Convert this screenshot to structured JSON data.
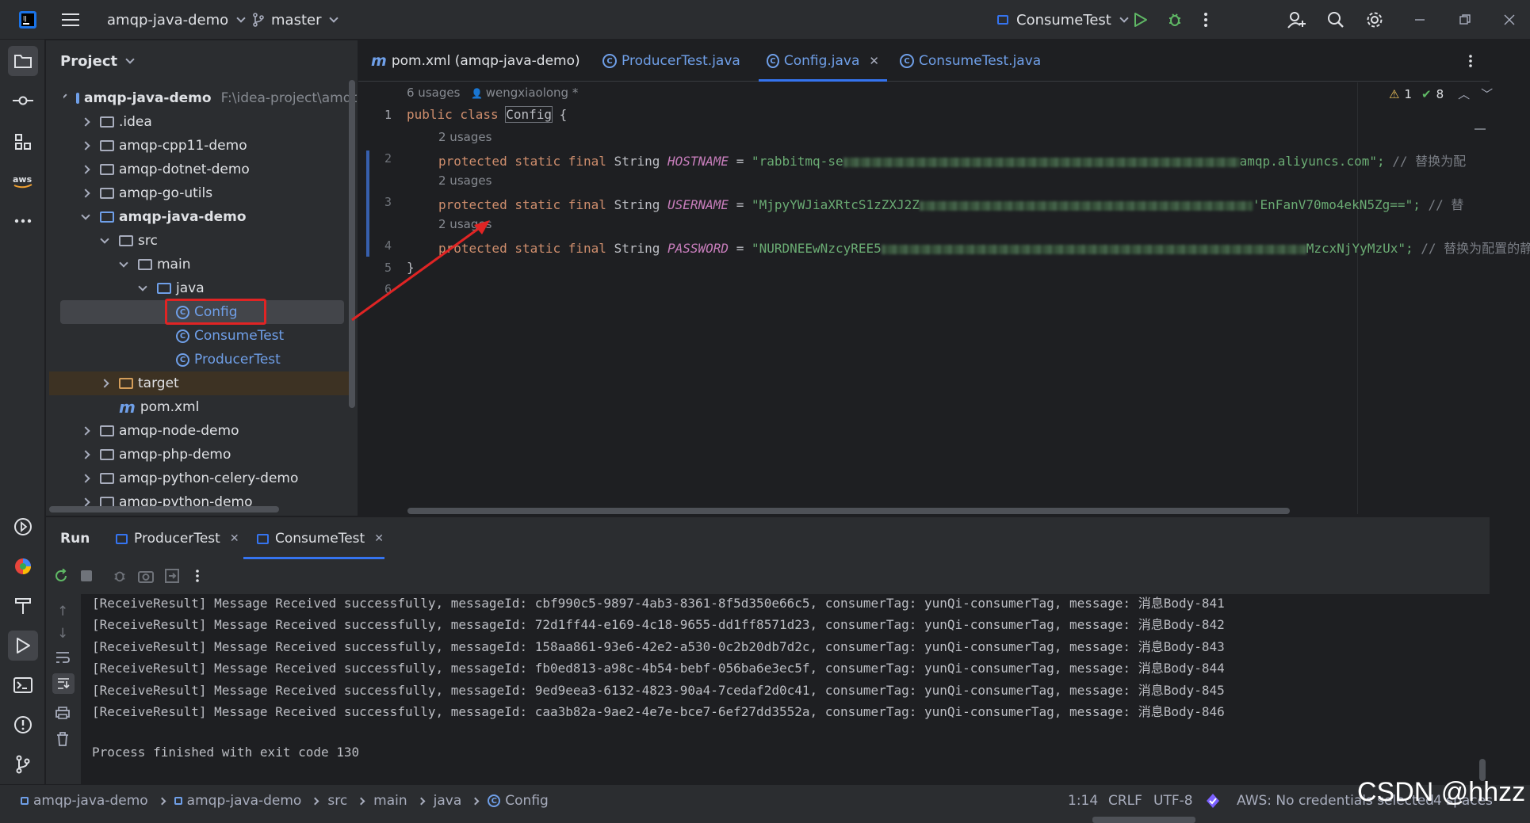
{
  "titlebar": {
    "project_name": "amqp-java-demo",
    "branch": "master",
    "run_config": "ConsumeTest"
  },
  "project_panel": {
    "title": "Project",
    "root_name": "amqp-java-demo",
    "root_path": "F:\\idea-project\\amqp-j",
    "items": [
      {
        "label": ".idea"
      },
      {
        "label": "amqp-cpp11-demo"
      },
      {
        "label": "amqp-dotnet-demo"
      },
      {
        "label": "amqp-go-utils"
      },
      {
        "label": "amqp-java-demo"
      },
      {
        "label": "src"
      },
      {
        "label": "main"
      },
      {
        "label": "java"
      },
      {
        "label": "Config"
      },
      {
        "label": "ConsumeTest"
      },
      {
        "label": "ProducerTest"
      },
      {
        "label": "target"
      },
      {
        "label": "pom.xml"
      },
      {
        "label": "amqp-node-demo"
      },
      {
        "label": "amqp-php-demo"
      },
      {
        "label": "amqp-python-celery-demo"
      },
      {
        "label": "amqp-python-demo"
      }
    ]
  },
  "editor_tabs": [
    {
      "label": "pom.xml (amqp-java-demo)"
    },
    {
      "label": "ProducerTest.java"
    },
    {
      "label": "Config.java"
    },
    {
      "label": "ConsumeTest.java"
    }
  ],
  "editor": {
    "usages_top": "6 usages",
    "author": "wengxiaolong *",
    "warnings": "1",
    "checks": "8",
    "usage_hint": "2 usages",
    "line_numbers": [
      "1",
      "2",
      "3",
      "4",
      "5",
      "6"
    ],
    "line1_kw": "public class",
    "line1_name": "Config",
    "line1_brace": "{",
    "mods": "protected static final",
    "type": "String",
    "hostname_name": "HOSTNAME",
    "hostname_start": "\"rabbitmq-se",
    "hostname_end": "amqp.aliyuncs.com\";",
    "hostname_comment": "// 替换为配",
    "username_name": "USERNAME",
    "username_start": "\"MjpyYWJiaXRtcS1zZXJ2Z",
    "username_end": "'EnFanV70mo4ekN5Zg==\";",
    "username_comment": "// 替",
    "password_name": "PASSWORD",
    "password_start": "\"NURDNEEwNzcyREE5",
    "password_end": "MzcxNjYyMzUx\";",
    "password_comment": "// 替换为配置的静态",
    "eq": "=",
    "close_brace": "}"
  },
  "run_panel": {
    "title": "Run",
    "tabs": [
      {
        "label": "ProducerTest"
      },
      {
        "label": "ConsumeTest"
      }
    ],
    "lines": [
      "[ReceiveResult] Message Received successfully, messageId: cbf990c5-9897-4ab3-8361-8f5d350e66c5, consumerTag: yunQi-consumerTag, message: 消息Body-841",
      "[ReceiveResult] Message Received successfully, messageId: 72d1ff44-e169-4c18-9655-dd1ff8571d23, consumerTag: yunQi-consumerTag, message: 消息Body-842",
      "[ReceiveResult] Message Received successfully, messageId: 158aa861-93e6-42e2-a530-0c2b20db7d2c, consumerTag: yunQi-consumerTag, message: 消息Body-843",
      "[ReceiveResult] Message Received successfully, messageId: fb0ed813-a98c-4b54-bebf-056ba6e3ec5f, consumerTag: yunQi-consumerTag, message: 消息Body-844",
      "[ReceiveResult] Message Received successfully, messageId: 9ed9eea3-6132-4823-90a4-7cedaf2d0c41, consumerTag: yunQi-consumerTag, message: 消息Body-845",
      "[ReceiveResult] Message Received successfully, messageId: caa3b82a-9ae2-4e7e-bce7-6ef27dd3552a, consumerTag: yunQi-consumerTag, message: 消息Body-846"
    ],
    "exit_line": "Process finished with exit code 130"
  },
  "statusbar": {
    "breadcrumb": [
      "amqp-java-demo",
      "amqp-java-demo",
      "src",
      "main",
      "java",
      "Config"
    ],
    "position": "1:14",
    "line_sep": "CRLF",
    "encoding": "UTF-8",
    "aws": "AWS: No credentials selected",
    "indent": "4 spaces"
  },
  "watermark": "CSDN @hhzz",
  "colors": {
    "accent": "#3574f0",
    "annotation": "#e02424"
  }
}
